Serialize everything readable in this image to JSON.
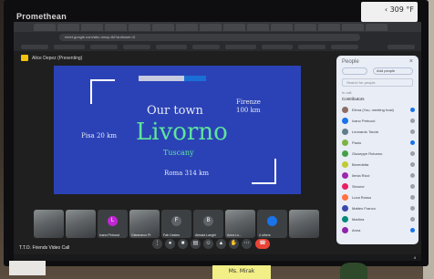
{
  "monitor": {
    "brand": "Promethean",
    "system_text": "‹ 309 °F"
  },
  "browser": {
    "url": "meet.google.com/abc-mnop-tkl?authuser=0"
  },
  "meet": {
    "presenting_label": "Alice Depez (Presenting)",
    "meeting_name": "T.T.O. Friends Video Call",
    "slide": {
      "title_line": "Our town",
      "city": "Livorno",
      "region": "Tuscany",
      "north_city": "Firenze",
      "north_dist": "100 km",
      "west_label": "Pisa 20 km",
      "south_label": "Roma 314 km"
    },
    "tiles": [
      {
        "name": "",
        "initial": ""
      },
      {
        "name": "",
        "initial": ""
      },
      {
        "name": "Ivano Petrucci",
        "initial": "L"
      },
      {
        "name": "Gianmarco Pr",
        "initial": ""
      },
      {
        "name": "Fab Casteo",
        "initial": "F"
      },
      {
        "name": "Alessia Langhi",
        "initial": "B"
      },
      {
        "name": "Anna Lu...",
        "initial": ""
      },
      {
        "name": "4 others",
        "initial": ""
      },
      {
        "name": "",
        "initial": ""
      }
    ],
    "people_panel": {
      "title": "People",
      "add_people": "Add people",
      "search_placeholder": "Search for people",
      "section_label": "In call",
      "contributors_label": "Contributors",
      "participants": [
        "Elena (You, meeting host)",
        "Ivano Petrucci",
        "Leonardo Tonda",
        "Paolo",
        "Giuseppe Rotunno",
        "Benedetta",
        "Ilenia Ricci",
        "Simone",
        "Luca Rosso",
        "Matteo Franco",
        "Martina",
        "Anna"
      ]
    },
    "time": "4"
  },
  "foreground": {
    "sticker": "Ms. Mirak"
  }
}
